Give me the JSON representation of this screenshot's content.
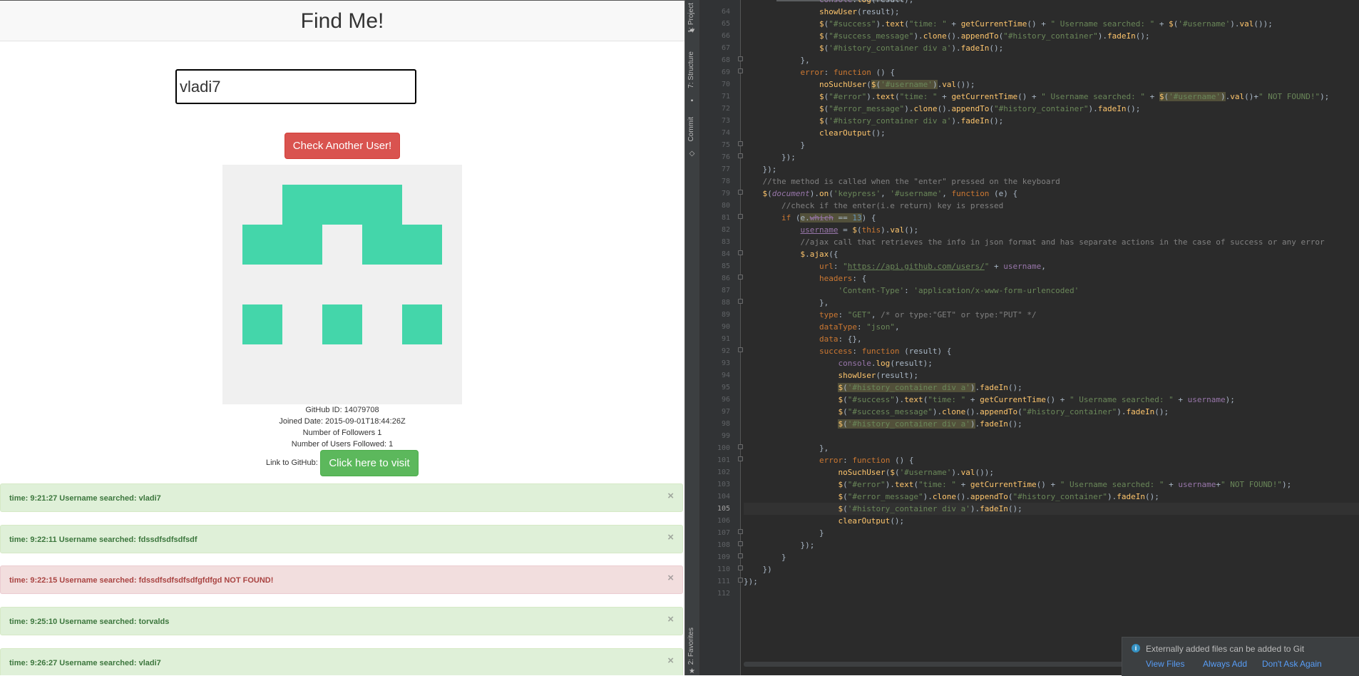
{
  "browser": {
    "title": "Find Me!",
    "search_value": "vladi7",
    "check_button": "Check Another User!",
    "profile": {
      "github_id": "GitHub ID: 14079708",
      "joined": "Joined Date: 2015-09-01T18:44:26Z",
      "followers": "Number of Followers 1",
      "following": "Number of Users Followed: 1",
      "link_label": "Link to GitHub:",
      "visit_button": "Click here to visit"
    },
    "avatar_color": "#44d6aa",
    "history": [
      {
        "text": "time: 9:21:27 Username searched: vladi7",
        "status": "success"
      },
      {
        "text": "time: 9:22:11 Username searched: fdssdfsdfsdfsdf",
        "status": "success"
      },
      {
        "text": "time: 9:22:15 Username searched: fdssdfsdfsdfsdfgfdfgd NOT FOUND!",
        "status": "danger"
      },
      {
        "text": "time: 9:25:10 Username searched: torvalds",
        "status": "success"
      },
      {
        "text": "time: 9:26:27 Username searched: vladi7",
        "status": "success"
      }
    ],
    "close_glyph": "×"
  },
  "ide": {
    "tool_tabs": [
      "1: Project",
      "7: Structure",
      "Commit",
      "2: Favorites"
    ],
    "current_line": 105,
    "line_numbers": [
      64,
      65,
      66,
      67,
      68,
      69,
      70,
      71,
      72,
      73,
      74,
      75,
      76,
      77,
      78,
      79,
      80,
      81,
      82,
      83,
      84,
      85,
      86,
      87,
      88,
      89,
      90,
      91,
      92,
      93,
      94,
      95,
      96,
      97,
      98,
      99,
      100,
      101,
      102,
      103,
      104,
      105,
      106,
      107,
      108,
      109,
      110,
      111,
      112
    ],
    "notification": {
      "message": "Externally added files can be added to Git",
      "actions": [
        "View Files",
        "Always Add",
        "Don't Ask Again"
      ]
    }
  }
}
